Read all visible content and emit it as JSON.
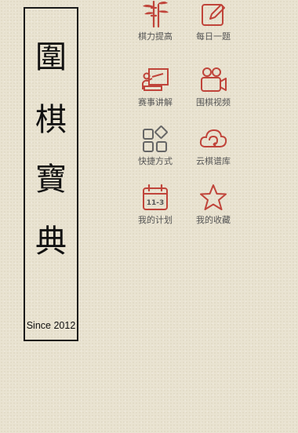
{
  "title": {
    "chars": [
      "圍",
      "棋",
      "寶",
      "典"
    ],
    "since": "Since 2012"
  },
  "menu": {
    "items": [
      {
        "label": "棋力提高",
        "icon": "bamboo-icon"
      },
      {
        "label": "每日一题",
        "icon": "edit-icon"
      },
      {
        "label": "赛事讲解",
        "icon": "lecture-icon"
      },
      {
        "label": "围棋视频",
        "icon": "video-camera-icon"
      },
      {
        "label": "快捷方式",
        "icon": "shortcut-grid-icon"
      },
      {
        "label": "云棋谱库",
        "icon": "cloud-icon"
      },
      {
        "label": "我的计划",
        "icon": "calendar-icon",
        "badge": "11-3"
      },
      {
        "label": "我的收藏",
        "icon": "star-icon"
      }
    ]
  },
  "colors": {
    "accent": "#c0443a",
    "icon_gray": "#666666",
    "text": "#555555"
  }
}
